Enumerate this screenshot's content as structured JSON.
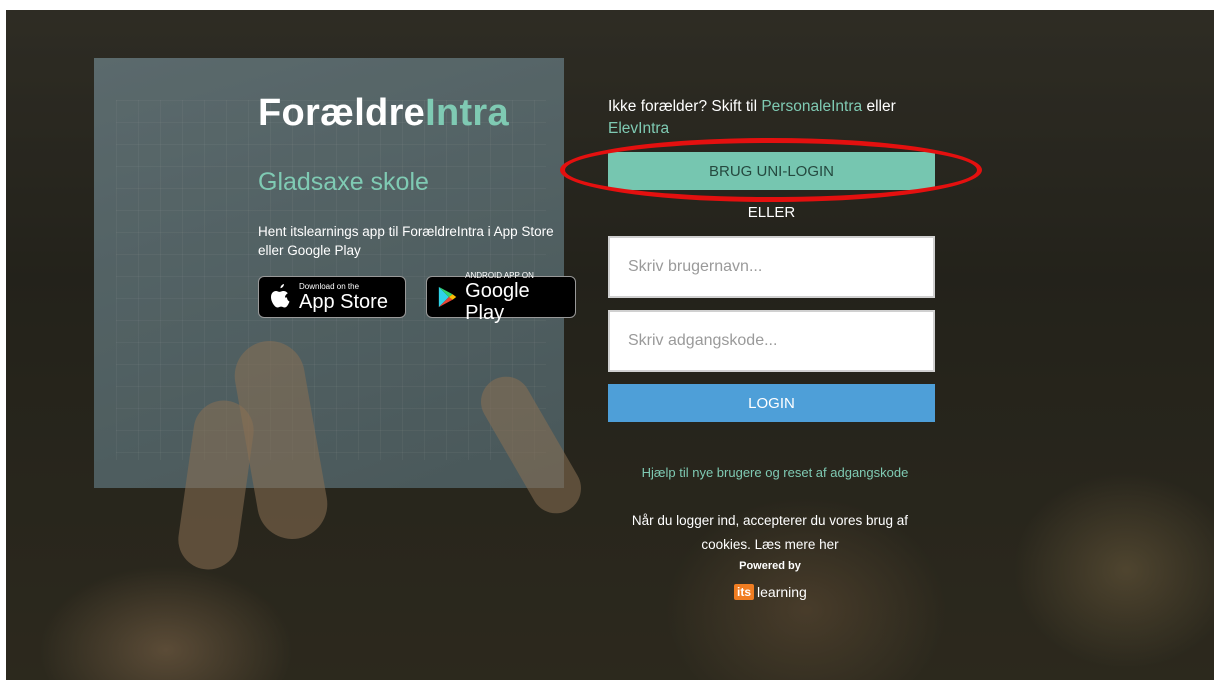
{
  "brand": {
    "part1": "Forældre",
    "part2": "Intra"
  },
  "school_name": "Gladsaxe skole",
  "app_promo": "Hent itslearnings app til ForældreIntra i App Store eller Google Play",
  "stores": {
    "apple": {
      "small": "Download on the",
      "big": "App Store",
      "icon": "apple-icon"
    },
    "google": {
      "small": "ANDROID APP ON",
      "big": "Google Play",
      "icon": "google-play-icon"
    }
  },
  "switch": {
    "prefix": "Ikke forælder? Skift til ",
    "link1": "PersonaleIntra",
    "middle": " eller ",
    "link2": "ElevIntra"
  },
  "uni_login_label": "BRUG UNI-LOGIN",
  "or_label": "ELLER",
  "username": {
    "placeholder": "Skriv brugernavn..."
  },
  "password": {
    "placeholder": "Skriv adgangskode..."
  },
  "login_label": "LOGIN",
  "help_link": "Hjælp til nye brugere og reset af adgangskode",
  "cookie_text": "Når du logger ind, accepterer du vores brug af cookies. Læs mere her",
  "powered_by": "Powered by",
  "its_logo": {
    "box": "its",
    "word": "learning"
  },
  "colors": {
    "accent": "#7fcab3",
    "uni_button": "#76c6b0",
    "login_button": "#4e9fd8",
    "highlight": "#e4100f"
  }
}
